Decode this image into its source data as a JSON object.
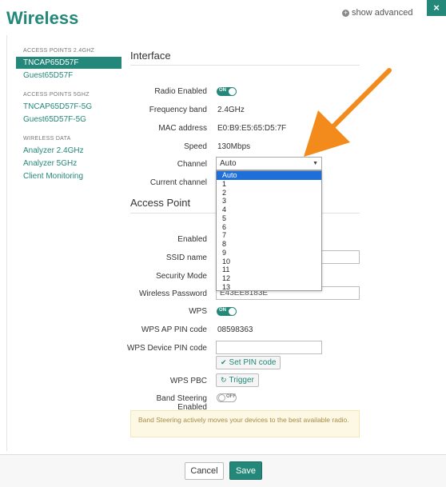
{
  "header": {
    "title": "Wireless",
    "close_icon": "×",
    "show_advanced": "show advanced",
    "plus_icon": "+"
  },
  "sidebar": {
    "sections": [
      {
        "title": "ACCESS POINTS 2.4GHZ",
        "items": [
          {
            "label": "TNCAP65D57F",
            "active": true
          },
          {
            "label": "Guest65D57F",
            "active": false
          }
        ]
      },
      {
        "title": "ACCESS POINTS 5GHZ",
        "items": [
          {
            "label": "TNCAP65D57F-5G",
            "active": false
          },
          {
            "label": "Guest65D57F-5G",
            "active": false
          }
        ]
      },
      {
        "title": "WIRELESS DATA",
        "items": [
          {
            "label": "Analyzer 2.4GHz",
            "active": false
          },
          {
            "label": "Analyzer 5GHz",
            "active": false
          },
          {
            "label": "Client Monitoring",
            "active": false
          }
        ]
      }
    ]
  },
  "interface": {
    "title": "Interface",
    "radio_enabled_label": "Radio Enabled",
    "radio_enabled_state": "ON",
    "frequency_band_label": "Frequency band",
    "frequency_band_value": "2.4GHz",
    "mac_address_label": "MAC address",
    "mac_address_value": "E0:B9:E5:65:D5:7F",
    "speed_label": "Speed",
    "speed_value": "130Mbps",
    "channel_label": "Channel",
    "channel_selected": "Auto",
    "channel_options": [
      "Auto",
      "1",
      "2",
      "3",
      "4",
      "5",
      "6",
      "7",
      "8",
      "9",
      "10",
      "11",
      "12",
      "13"
    ],
    "current_channel_label": "Current channel"
  },
  "access_point": {
    "title": "Access Point",
    "enabled_label": "Enabled",
    "ssid_label": "SSID name",
    "security_mode_label": "Security Mode",
    "wireless_password_label": "Wireless Password",
    "wireless_password_value": "E43EE8183E",
    "wps_label": "WPS",
    "wps_state": "ON",
    "wps_ap_pin_label": "WPS AP PIN code",
    "wps_ap_pin_value": "08598363",
    "wps_device_pin_label": "WPS Device PIN code",
    "set_pin_button": "Set PIN code",
    "wps_pbc_label": "WPS PBC",
    "trigger_button": "Trigger",
    "band_steering_label": "Band Steering Enabled",
    "band_steering_state": "OFF",
    "band_steering_notice": "Band Steering actively moves your devices to the best available radio."
  },
  "footer": {
    "cancel_label": "Cancel",
    "save_label": "Save"
  },
  "colors": {
    "accent": "#23887a",
    "annotation_arrow": "#f28a1c",
    "selected_option": "#1e6fd9"
  }
}
